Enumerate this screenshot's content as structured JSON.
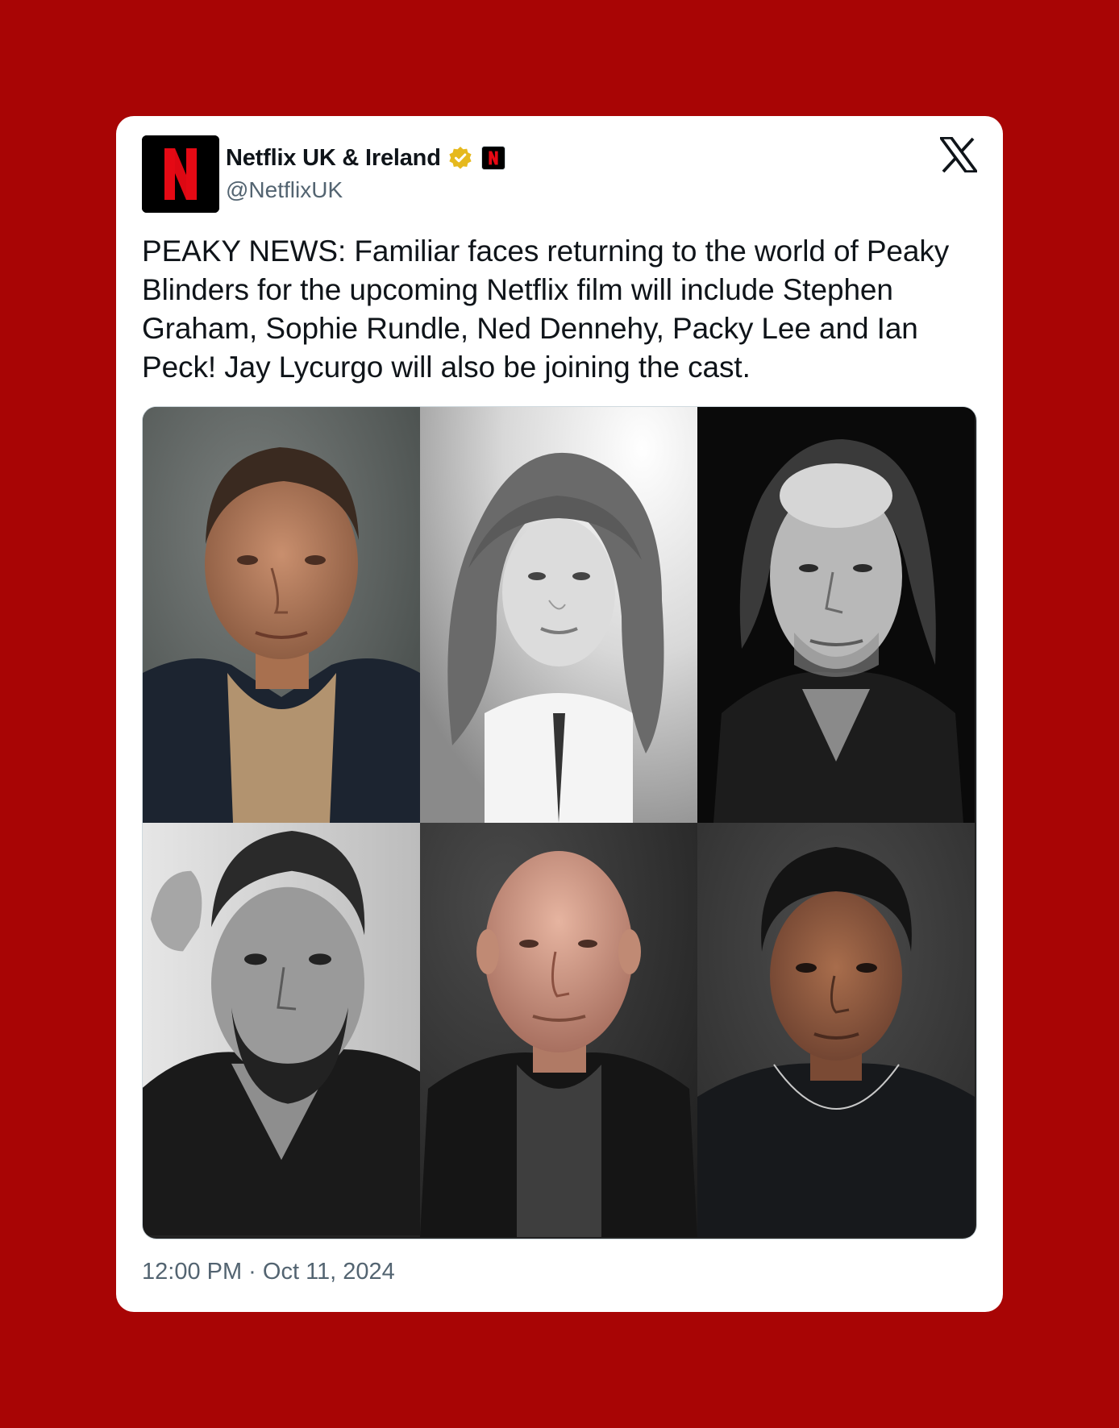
{
  "tweet": {
    "author": {
      "display_name": "Netflix UK & Ireland",
      "handle": "@NetflixUK",
      "avatar_letter": "N",
      "verified": true,
      "verified_badge_color": "#e6b91e",
      "affiliate_badge_letter": "N"
    },
    "text": "PEAKY NEWS: Familiar faces returning to the world of Peaky Blinders for the upcoming Netflix film will include Stephen Graham, Sophie Rundle, Ned Dennehy, Packy Lee and Ian Peck! Jay Lycurgo will also be joining the cast.",
    "timestamp": "12:00 PM · Oct 11, 2024",
    "media": {
      "layout": "grid 3x2",
      "photos": [
        {
          "tone": "color",
          "icon": "portrait-photo"
        },
        {
          "tone": "black-and-white",
          "icon": "portrait-photo"
        },
        {
          "tone": "black-and-white",
          "icon": "portrait-photo"
        },
        {
          "tone": "black-and-white",
          "icon": "portrait-photo"
        },
        {
          "tone": "color",
          "icon": "portrait-photo"
        },
        {
          "tone": "color",
          "icon": "portrait-photo"
        }
      ]
    }
  },
  "colors": {
    "page_background": "#a80505",
    "card_background": "#ffffff",
    "netflix_red": "#e50914",
    "primary_text": "#0f1419",
    "secondary_text": "#536471"
  },
  "platform_icon": "x-logo-icon"
}
